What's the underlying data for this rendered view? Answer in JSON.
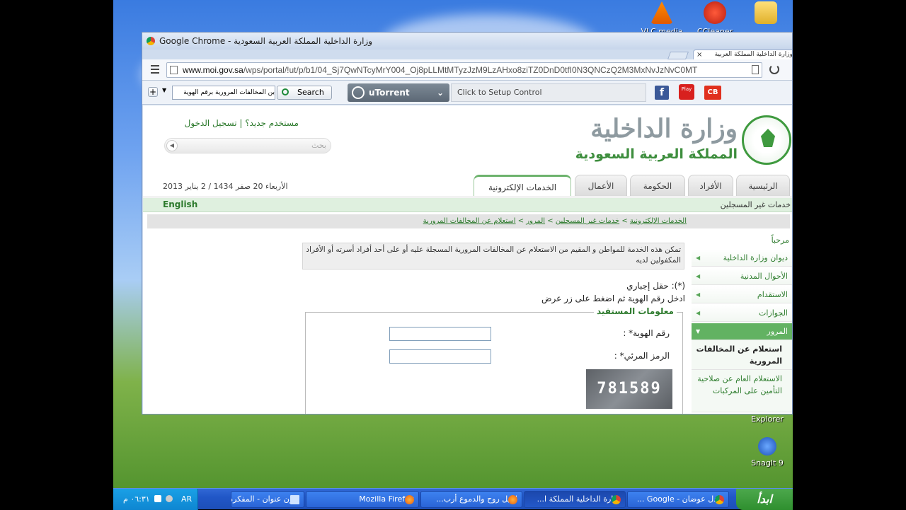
{
  "desktop": {
    "icons": [
      {
        "label": "VLC media"
      },
      {
        "label": "CCleaner"
      },
      {
        "label": ""
      }
    ],
    "bottom_icons": [
      {
        "label": "Explorer"
      },
      {
        "label": "SnagIt 9"
      }
    ]
  },
  "taskbar": {
    "start_label": "ابدأ",
    "clock": "٠٦:٣١ م",
    "lang": "AR",
    "items": [
      {
        "label": "عادل عوضان - Google ...",
        "active": false
      },
      {
        "label": "وزارة الداخلية المملكة ا...",
        "active": true
      },
      {
        "label": "الليل روح والدموع أرب...",
        "active": false
      },
      {
        "label": "Mozilla Firefox",
        "active": false
      },
      {
        "label": "بدون عنوان - المفكرة",
        "active": false
      }
    ]
  },
  "browser": {
    "title": "Google Chrome - وزارة الداخلية المملكة العربية السعودية",
    "tab_label": "وزارة الداخلية المملكة العربية",
    "url_host": "www.moi.gov.sa",
    "url_path": "/wps/portal/!ut/p/b1/04_Sj7QwNTcyMrY004_Oj8pLLMtMTyzJzM9LzAHxo8ziTZ0DnD0tfI0N3QNCzQ2M3MxNvJzNvC0MT",
    "ext_search_value": "بن المخالفات المرورية برقم الهوية",
    "ext_search_button": "Search",
    "utorrent_label": "uTorrent",
    "setup_control": "Click to Setup Control",
    "play_label": "Play",
    "cb_label": "CB"
  },
  "page": {
    "logo_line1": "وزارة الداخلية",
    "logo_line2": "المملكة العربية السعودية",
    "new_user": "مستخدم جديد؟",
    "login": "تسجيل الدخول",
    "search_placeholder": "بحث",
    "date_text": "الأربعاء 20 صفر 1434 / 2 يناير 2013",
    "nav_tabs": [
      "الرئيسية",
      "الأفراد",
      "الحكومة",
      "الأعمال",
      "الخدمات الإلكترونية"
    ],
    "section_title": "خدمات غير المسجلين",
    "english_link": "English",
    "breadcrumb": [
      "الخدمات الإلكترونية",
      "خدمات غير المسجلين",
      "المرور",
      "استعلام عن المخالفات المرورية"
    ],
    "welcome": "مرحباً",
    "sidebar": [
      "ديوان وزارة الداخلية",
      "الأحوال المدنية",
      "الاستقدام",
      "الجوازات",
      "المرور"
    ],
    "sub_items": [
      "استعلام عن المخالفات المرورية",
      "الاستعلام العام عن صلاحية التأمين على المركبات"
    ],
    "intro": "تمكن هذه الخدمة للمواطن و المقيم من الاستعلام عن المخالفات المرورية المسجلة عليه أو على أحد أفراد أسرته أو الأفراد المكفولين لديه",
    "required_note": "(*): حقل إجباري",
    "instruction": "ادخل رقم الهوية ثم اضغط على زر عرض",
    "fieldset_legend": "معلومات المستفيد",
    "id_label": "رقم الهوية* :",
    "captcha_label": "الرمز المرئي* :",
    "captcha_value": "781589"
  }
}
